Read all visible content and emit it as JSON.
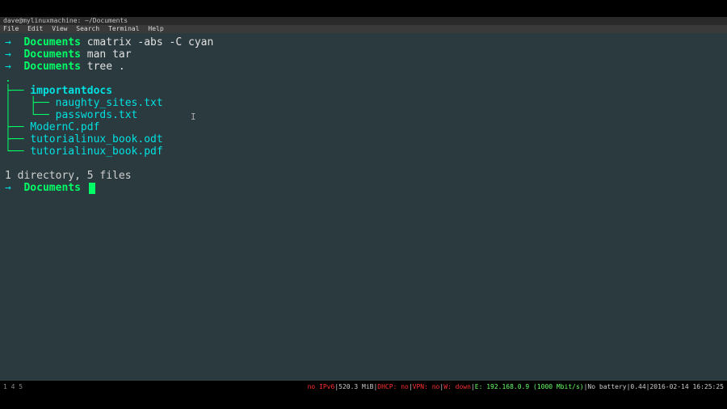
{
  "titlebar": {
    "left": "dave@mylinuxmachine: ~/Documents"
  },
  "menubar": {
    "items": [
      "File",
      "Edit",
      "View",
      "Search",
      "Terminal",
      "Help"
    ]
  },
  "terminal": {
    "lines": [
      {
        "type": "prompt",
        "arrow": "→",
        "cwd": "Documents",
        "cmd": "cmatrix -abs -C cyan"
      },
      {
        "type": "prompt",
        "arrow": "→",
        "cwd": "Documents",
        "cmd": "man tar"
      },
      {
        "type": "prompt",
        "arrow": "→",
        "cwd": "Documents",
        "cmd": "tree ."
      },
      {
        "type": "tree",
        "branch": ".",
        "name": ""
      },
      {
        "type": "tree",
        "branch": "├── ",
        "name": "importantdocs",
        "isdir": true
      },
      {
        "type": "tree",
        "branch": "│   ├── ",
        "name": "naughty_sites.txt"
      },
      {
        "type": "tree",
        "branch": "│   └── ",
        "name": "passwords.txt"
      },
      {
        "type": "tree",
        "branch": "├── ",
        "name": "ModernC.pdf"
      },
      {
        "type": "tree",
        "branch": "├── ",
        "name": "tutorialinux_book.odt"
      },
      {
        "type": "tree",
        "branch": "└── ",
        "name": "tutorialinux_book.pdf"
      },
      {
        "type": "blank"
      },
      {
        "type": "summary",
        "text": "1 directory, 5 files"
      },
      {
        "type": "prompt",
        "arrow": "→",
        "cwd": "Documents",
        "cmd": "",
        "cursor": true
      }
    ]
  },
  "statusbar": {
    "left": "1  4  5",
    "right_parts": [
      {
        "cls": "st-red",
        "text": "no IPv6"
      },
      {
        "cls": "st-white",
        "text": "|520.3 MiB|"
      },
      {
        "cls": "st-red",
        "text": "DHCP: no"
      },
      {
        "cls": "st-white",
        "text": "|"
      },
      {
        "cls": "st-red",
        "text": "VPN: no"
      },
      {
        "cls": "st-white",
        "text": "|"
      },
      {
        "cls": "st-red",
        "text": "W: down"
      },
      {
        "cls": "st-white",
        "text": "|"
      },
      {
        "cls": "st-green",
        "text": "E: 192.168.0.9 (1000 Mbit/s)"
      },
      {
        "cls": "st-white",
        "text": "|No battery|0.44|2016-02-14 16:25:25 "
      }
    ]
  }
}
